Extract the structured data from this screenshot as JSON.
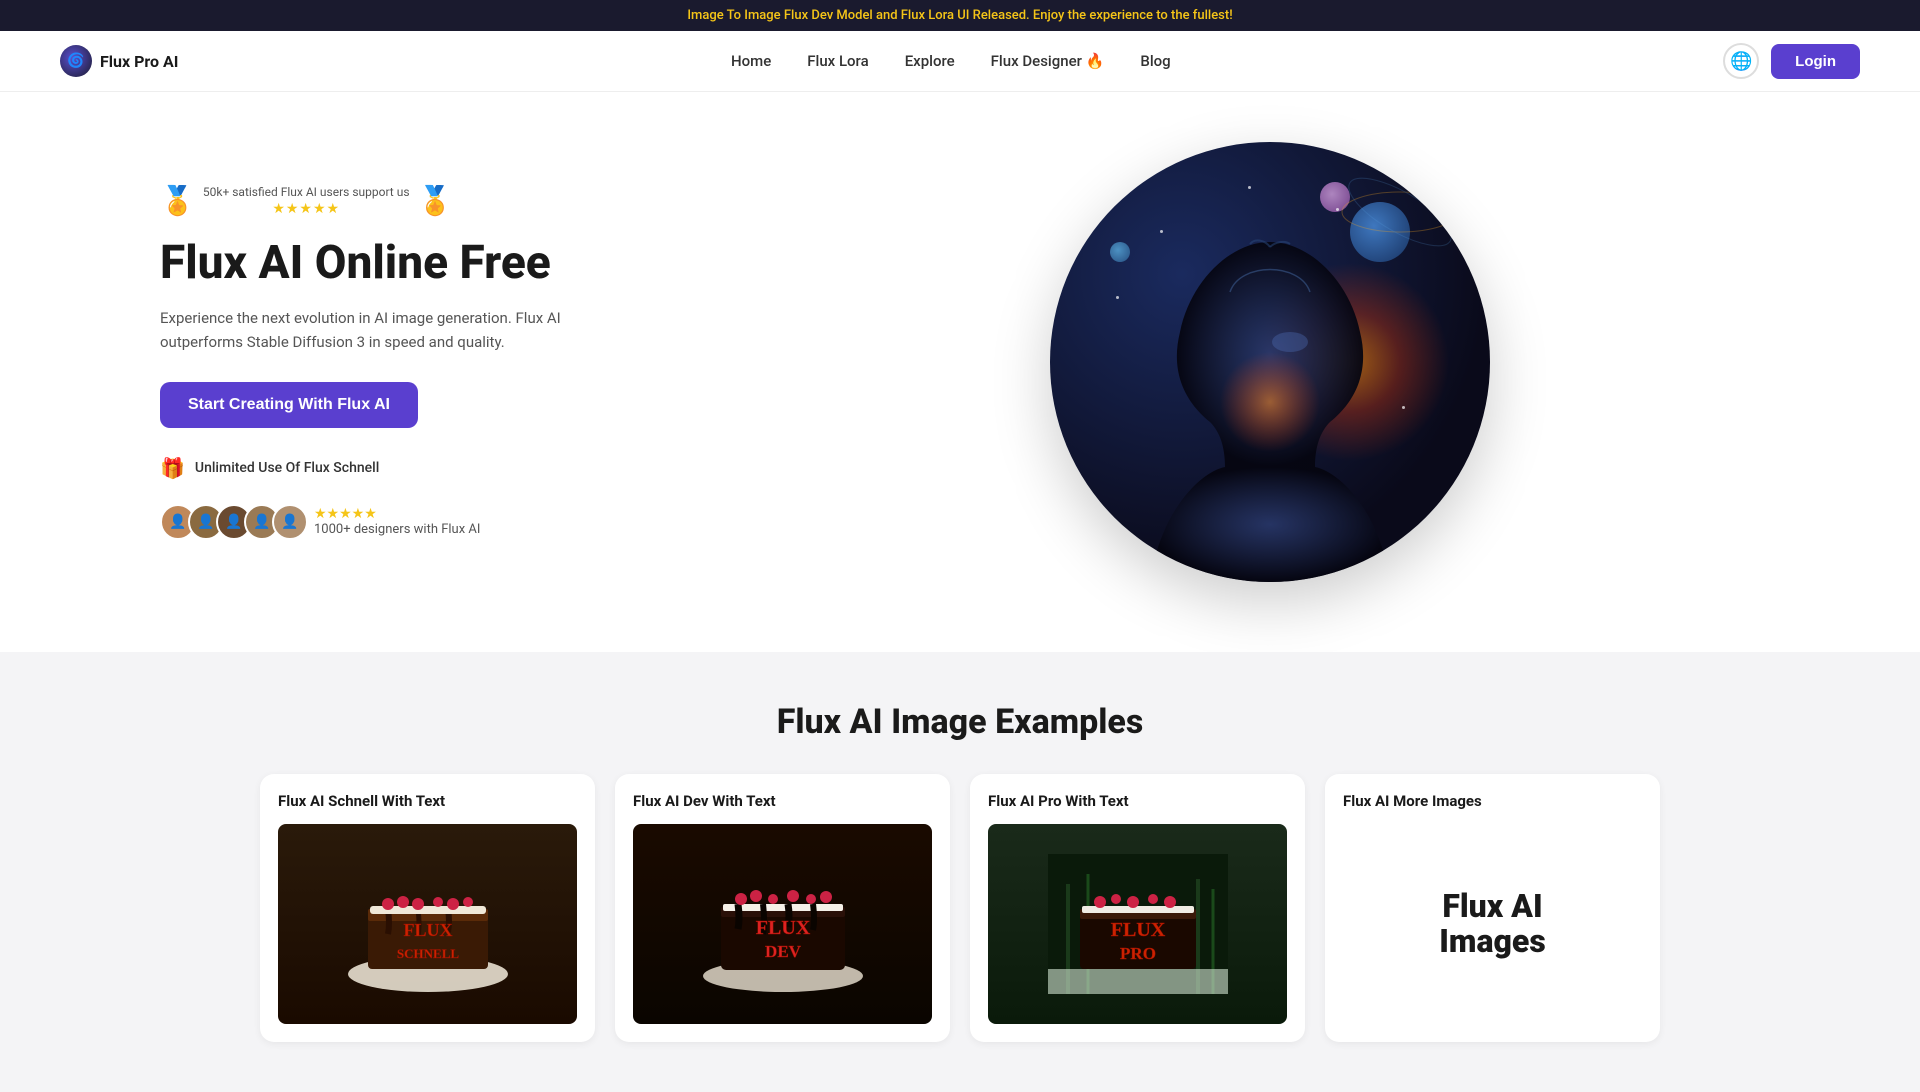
{
  "banner": {
    "text": "Image To Image Flux Dev Model and Flux Lora UI Released. Enjoy the experience to the fullest!"
  },
  "header": {
    "logo_text": "Flux Pro AI",
    "logo_icon": "🌀",
    "nav": [
      {
        "label": "Home",
        "id": "home"
      },
      {
        "label": "Flux Lora",
        "id": "flux-lora"
      },
      {
        "label": "Explore",
        "id": "explore"
      },
      {
        "label": "Flux Designer 🔥",
        "id": "flux-designer"
      },
      {
        "label": "Blog",
        "id": "blog"
      }
    ],
    "login_label": "Login",
    "globe_icon": "🌐"
  },
  "hero": {
    "badge_text": "50k+ satisfied Flux AI users support us",
    "stars": "★★★★★",
    "title": "Flux AI Online Free",
    "subtitle": "Experience the next evolution in AI image generation. Flux AI outperforms Stable Diffusion 3 in speed and quality.",
    "cta_label": "Start Creating With Flux AI",
    "unlimited_label": "Unlimited Use Of Flux Schnell",
    "social_rating": "★★★★★",
    "social_text": "1000+ designers with Flux AI"
  },
  "examples": {
    "section_title": "Flux AI Image Examples",
    "cards": [
      {
        "id": "schnell",
        "title": "Flux AI Schnell With Text",
        "image_alt": "Flux Schnell cake with text decoration",
        "text_on_cake": "FLUX\nSCHNELL"
      },
      {
        "id": "dev",
        "title": "Flux AI Dev With Text",
        "image_alt": "Flux Dev cake with text decoration",
        "text_on_cake": "FLUX\nDEV"
      },
      {
        "id": "pro",
        "title": "Flux AI Pro With Text",
        "image_alt": "Flux Pro cake with text decoration",
        "text_on_cake": "FLUX\nPRO"
      },
      {
        "id": "more",
        "title": "Flux AI More Images",
        "image_alt": "More Flux AI images",
        "more_text_line1": "Flux AI",
        "more_text_line2": "Images"
      }
    ]
  }
}
